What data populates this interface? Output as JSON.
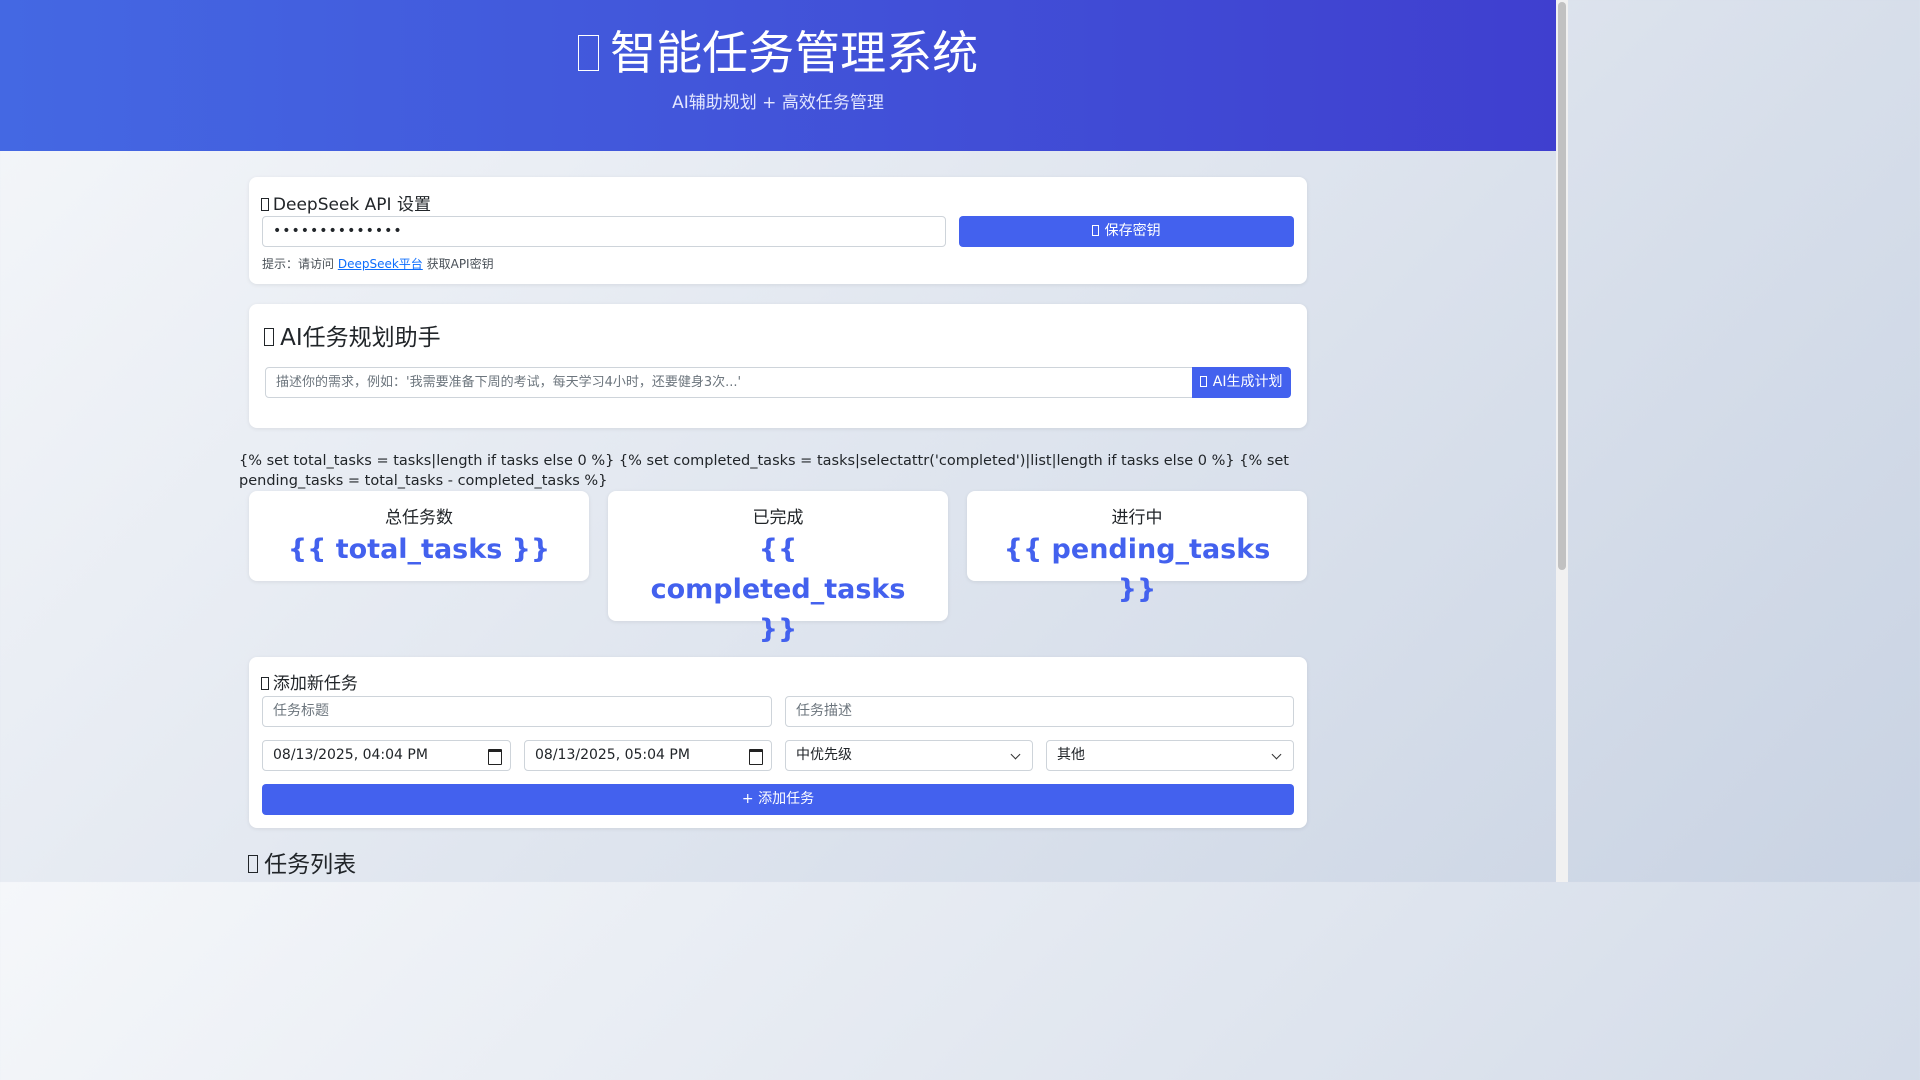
{
  "header": {
    "title": "智能任务管理系统",
    "subtitle": "AI辅助规划 + 高效任务管理"
  },
  "api_settings": {
    "title": "DeepSeek API 设置",
    "key_value": "••••••••••••••",
    "save_label": "保存密钥",
    "hint_prefix": "提示：请访问 ",
    "hint_link": "DeepSeek平台",
    "hint_suffix": " 获取API密钥"
  },
  "ai_planner": {
    "title": "AI任务规划助手",
    "placeholder": "描述你的需求，例如：'我需要准备下周的考试，每天学习4小时，还要健身3次...'",
    "generate_label": "AI生成计划"
  },
  "template_text": "{% set total_tasks = tasks|length if tasks else 0 %} {% set completed_tasks = tasks|selectattr('completed')|list|length if tasks else 0 %} {% set pending_tasks = total_tasks - completed_tasks %}",
  "stats": {
    "total_label": "总任务数",
    "total_value": "{{ total_tasks }}",
    "completed_label": "已完成",
    "completed_value": "{{ completed_tasks }}",
    "pending_label": "进行中",
    "pending_value": "{{ pending_tasks }}"
  },
  "add_task": {
    "title": "添加新任务",
    "title_placeholder": "任务标题",
    "desc_placeholder": "任务描述",
    "start_time": "08/13/2025, 04:04 PM",
    "end_time": "08/13/2025, 05:04 PM",
    "priority": "中优先级",
    "category": "其他",
    "add_label": "+ 添加任务"
  },
  "task_list": {
    "title": "任务列表"
  },
  "colors": {
    "accent": "#4361ee",
    "header_start": "#4468e3",
    "header_end": "#3f3fcf"
  }
}
